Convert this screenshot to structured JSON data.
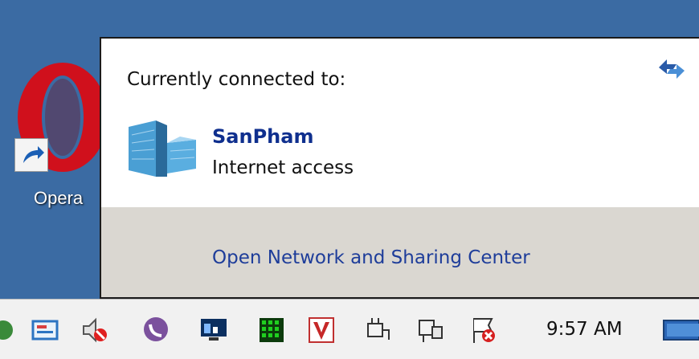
{
  "desktop": {
    "shortcut_label": "Opera"
  },
  "flyout": {
    "heading": "Currently connected to:",
    "network": {
      "name": "SanPham",
      "status": "Internet access"
    },
    "footer_link": "Open Network and Sharing Center"
  },
  "taskbar": {
    "clock": "9:57 AM",
    "tray_icons": [
      "action-center-icon",
      "message-icon",
      "volume-muted-icon",
      "viber-icon",
      "network-monitor-icon",
      "green-grid-icon",
      "antivirus-v-icon",
      "power-plug-icon",
      "network-cable-icon",
      "flag-error-icon",
      "show-desktop-icon"
    ]
  },
  "colors": {
    "desktop_bg": "#3b6ba3",
    "link": "#1e3d9a",
    "network_name": "#0f2f8e",
    "footer_bg": "#dad7d1"
  }
}
